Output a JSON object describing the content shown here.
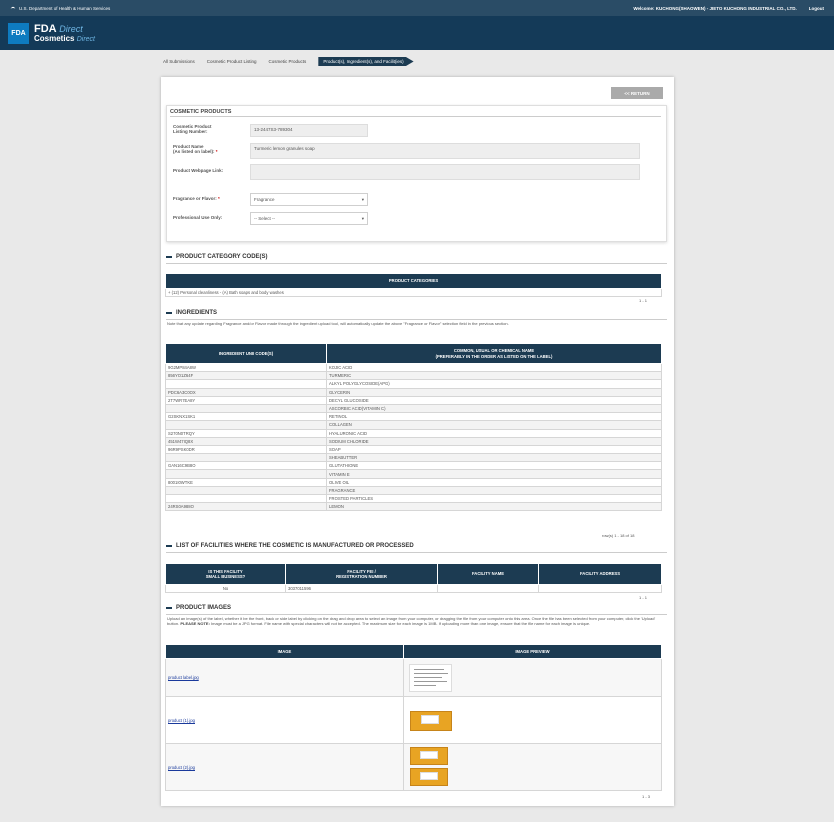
{
  "topbar": {
    "agency": "U.S. Department of Health & Human Services",
    "welcome": "Welcome: KUCHONG(SHAOWEN) - JIETO KUCHONG INDUSTRIAL CO., LTD.",
    "logout": "Logout"
  },
  "header": {
    "logo": "FDA",
    "brand_l1": "FDA",
    "brand_l1_italic": "Direct",
    "brand_l2": "Cosmetics",
    "brand_l2_italic": "Direct"
  },
  "breadcrumb": [
    "All Submissions",
    "Cosmetic Product Listing",
    "Cosmetic Products",
    "Product(s), Ingredient(s), and Facilit(ies)"
  ],
  "return_label": "<< RETURN",
  "cosmetic_products": {
    "title": "COSMETIC PRODUCTS",
    "listing_label": "Cosmetic Product\nListing Number:",
    "listing_value": "13-2447S3-789304",
    "name_label": "Product Name\n(As listed on label):",
    "name_value": "Turmeric lemon granules soap",
    "webpage_label": "Product Webpage Link:",
    "webpage_value": "",
    "fragrance_label": "Fragrance or Flavor:",
    "fragrance_value": "Fragrance",
    "professional_label": "Professional Use Only:",
    "professional_value": "-- Select --"
  },
  "category": {
    "title": "PRODUCT CATEGORY CODE(S)",
    "header": "PRODUCT CATEGORIES",
    "rows": [
      "+ (12) Personal cleanliness - (A) Bath soaps and body washes"
    ],
    "pager": "1 - 1"
  },
  "ingredients": {
    "title": "INGREDIENTS",
    "note": "Note that any update regarding Fragrance and/or Flavor made through the ingredient upload tool, will automatically update the above \"Fragrance or Flavor\" selection field in the previous section.",
    "col1": "INGREDIENT UNII CODE(S)",
    "col2": "COMMON, USUAL OR CHEMICAL NAME\n(PREFERABLY IN THE ORDER AS LISTED ON THE LABEL)",
    "rows": [
      [
        "9G2MP84A8W",
        "KOJIC ACID"
      ],
      [
        "856YO1Z64F",
        "TURMERIC"
      ],
      [
        "",
        "ALKYL POLYGLYCOSIDE(APG)"
      ],
      [
        "PDC6A3C0OX",
        "GLYCERIN"
      ],
      [
        "2T7WR7EA8Y",
        "DECYL GLUCOSIDE"
      ],
      [
        "",
        "ASCORBIC ACID(VITAMIN C)"
      ],
      [
        "G2SKNX1SK1",
        "RETINOL"
      ],
      [
        "",
        "COLLAGEN"
      ],
      [
        "S270N0TRQY",
        "HYALURONIC ACID"
      ],
      [
        "451W47IQ8X",
        "SODIUM CHLORIDE"
      ],
      [
        "96R9PSK0DR",
        "SOAP"
      ],
      [
        "",
        "SHEABUTTER"
      ],
      [
        "GAN16C9B8O",
        "GLUTATHIONE"
      ],
      [
        "",
        "VITAMIN E"
      ],
      [
        "8001I0WTKE",
        "OLIVE OIL"
      ],
      [
        "",
        "FRAGRANCE"
      ],
      [
        "",
        "FROSTED PARTICLES"
      ],
      [
        "24RS0A988O",
        "LEMON"
      ]
    ],
    "pager": "row(s) 1 - 18 of 18"
  },
  "facilities": {
    "title": "LIST OF FACILITIES WHERE THE COSMETIC IS MANUFACTURED OR PROCESSED",
    "col1": "IS THIS FACILITY\nSMALL BUSINESS?",
    "col2": "FACILITY FEI /\nREGISTRATION NUMBER",
    "col3": "FACILITY NAME",
    "col4": "FACILITY ADDRESS",
    "rows": [
      [
        "No",
        "3037011596",
        "",
        ""
      ]
    ],
    "pager": "1 - 1"
  },
  "images": {
    "title": "PRODUCT IMAGES",
    "note_pre": "Upload an image(s) of the label, whether it be the front, back or side label by clicking on the drag and drop area to select an image from your computer, or dragging the file from your computer onto this area. Once the file has been selected from your computer, click the 'Upload' button. ",
    "note_bold": "PLEASE NOTE:",
    "note_post": " Image must be a JPG format. File name with special characters will not be accepted. The maximum size for each image is 1MB. If uploading more than one image, ensure that the file name for each image is unique.",
    "col1": "IMAGE",
    "col2": "IMAGE PREVIEW",
    "files": [
      "product label.jpg",
      "product (1).jpg",
      "product (2).jpg"
    ],
    "pager": "1 - 3"
  },
  "colors": {
    "topbar": "#2a4c66",
    "header": "#143a58",
    "table_header": "#1c3b52",
    "accent": "#0e7bc0"
  }
}
